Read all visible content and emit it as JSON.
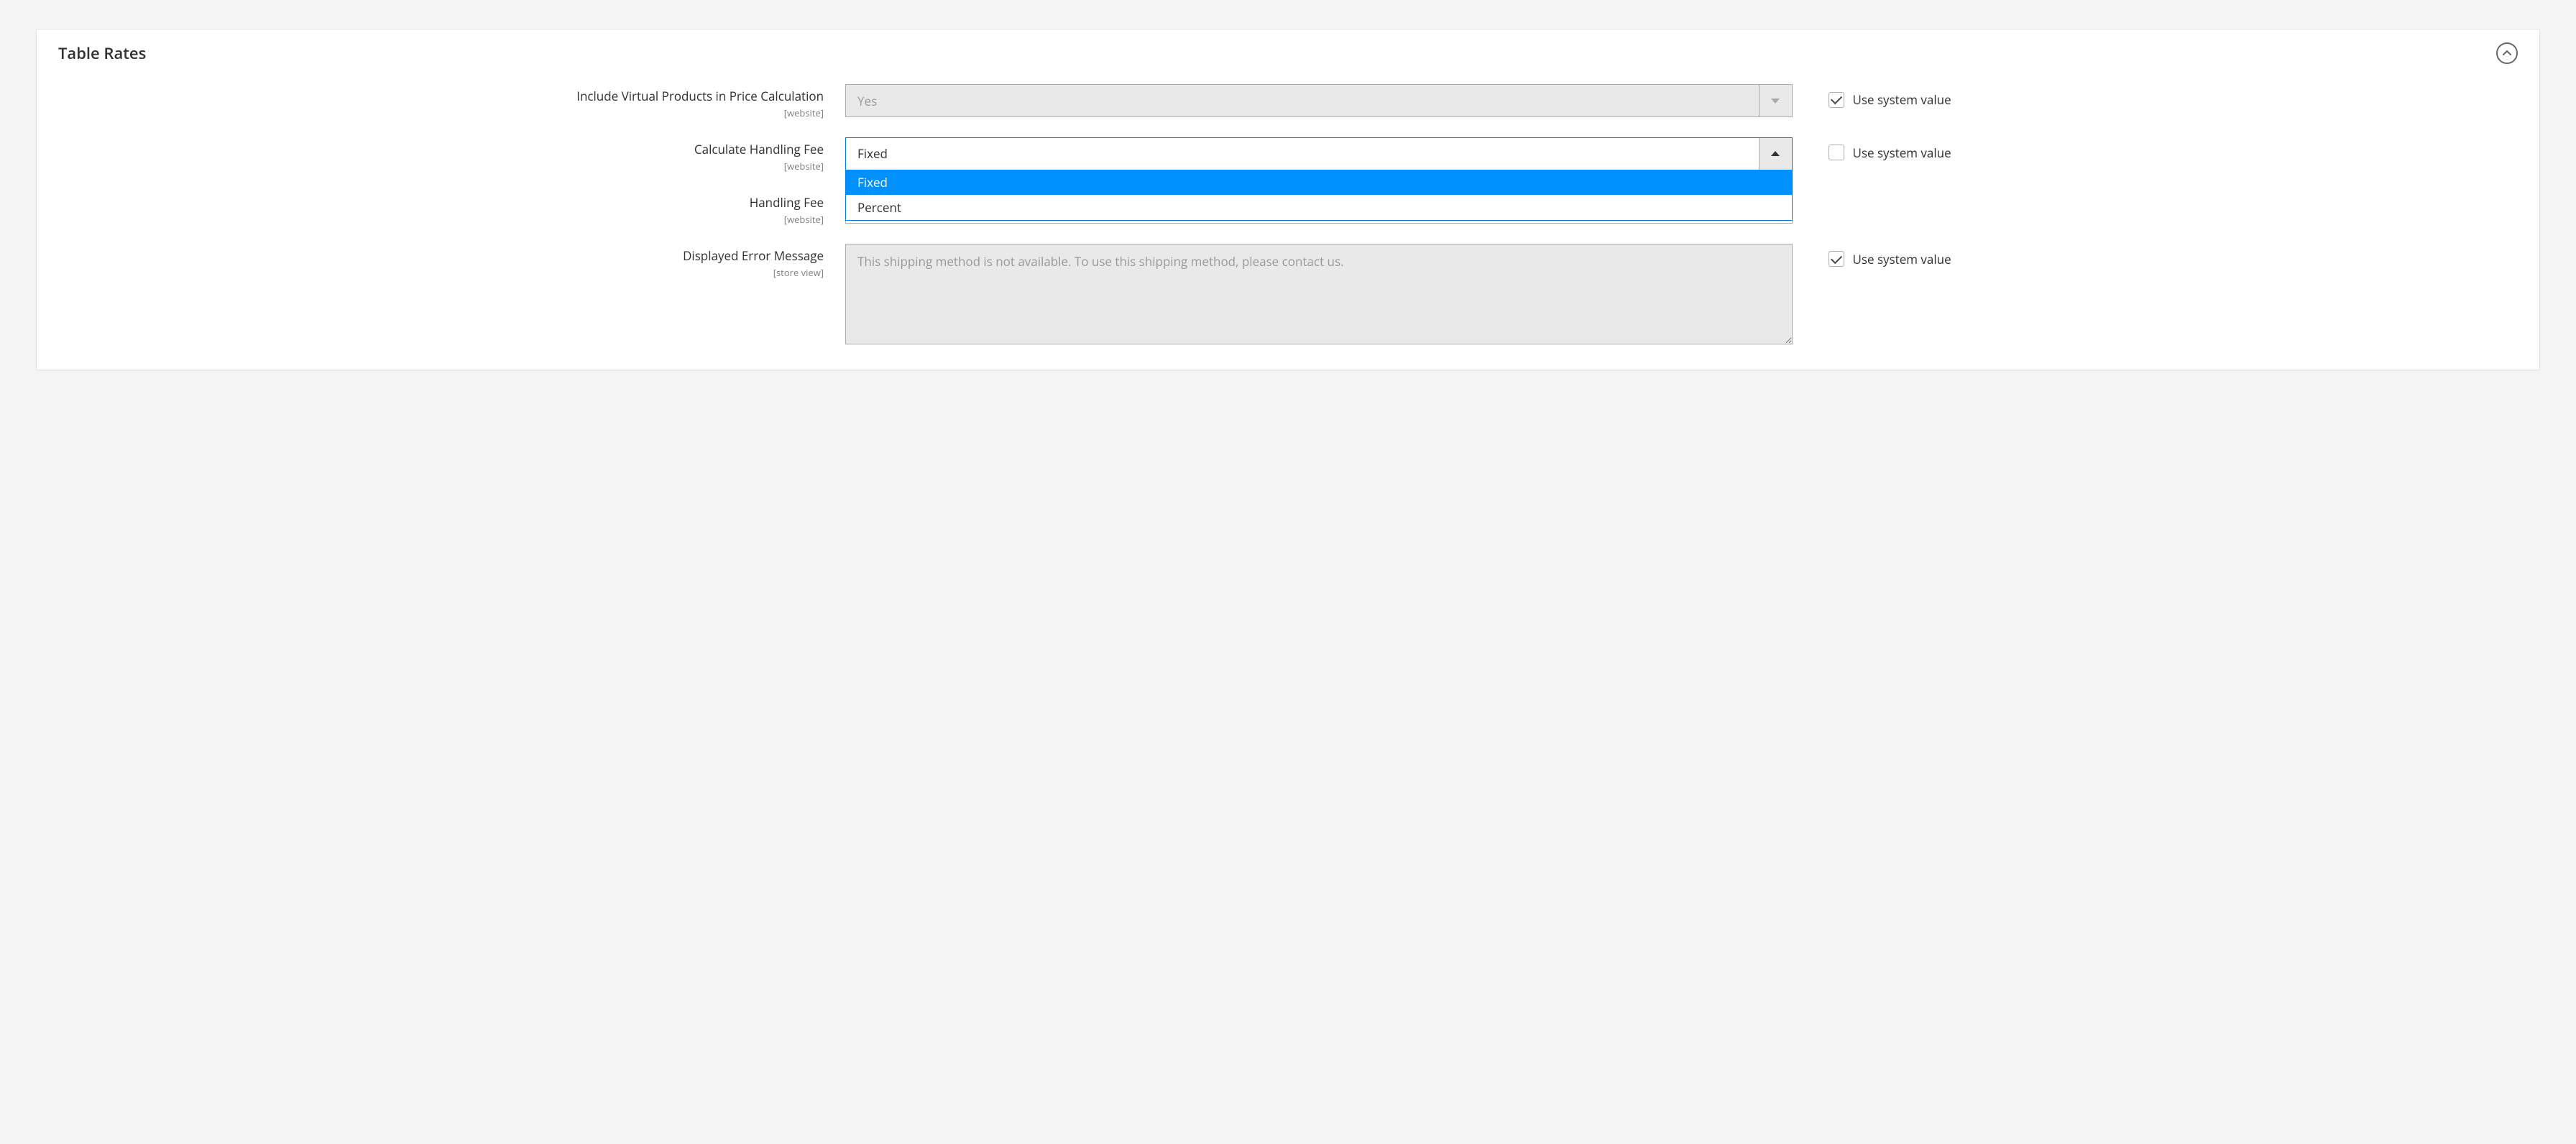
{
  "panel": {
    "title": "Table Rates"
  },
  "fields": {
    "include_virtual": {
      "label": "Include Virtual Products in Price Calculation",
      "scope": "[website]",
      "value": "Yes",
      "use_system_label": "Use system value",
      "use_system_checked": true
    },
    "handling_fee_type": {
      "label": "Calculate Handling Fee",
      "scope": "[website]",
      "value": "Fixed",
      "options": [
        "Fixed",
        "Percent"
      ],
      "use_system_label": "Use system value",
      "use_system_checked": false
    },
    "handling_fee": {
      "label": "Handling Fee",
      "scope": "[website]",
      "value": ""
    },
    "error_message": {
      "label": "Displayed Error Message",
      "scope": "[store view]",
      "value": "This shipping method is not available. To use this shipping method, please contact us.",
      "use_system_label": "Use system value",
      "use_system_checked": true
    }
  }
}
